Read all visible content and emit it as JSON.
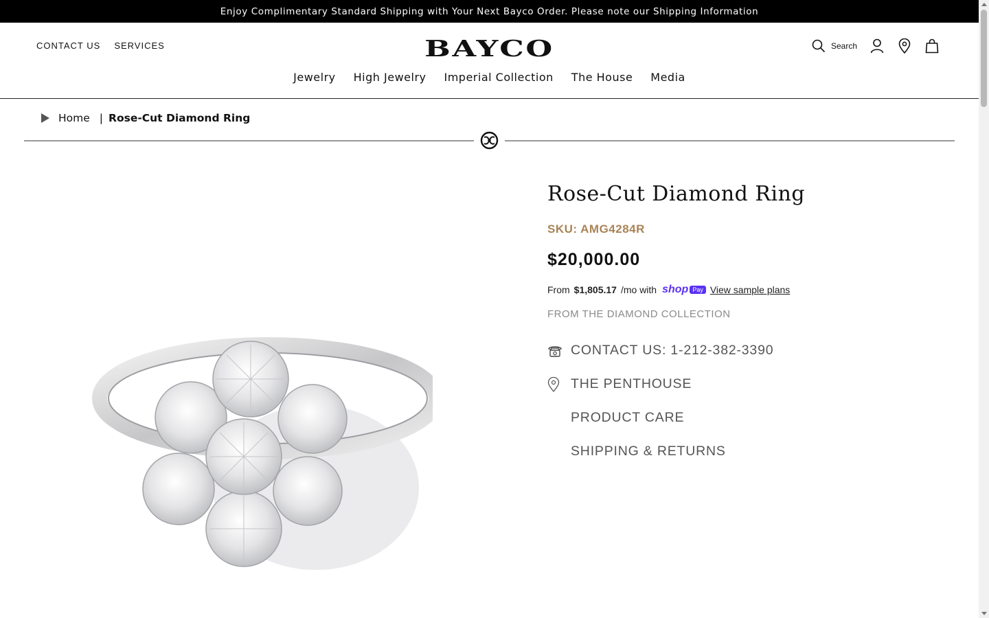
{
  "announcement": "Enjoy Complimentary Standard Shipping with Your Next Bayco Order. Please note our Shipping Information",
  "header": {
    "logo": "BAYCO",
    "util_left": [
      "CONTACT US",
      "SERVICES"
    ],
    "search_label": "Search",
    "icons": [
      "search-icon",
      "account-icon",
      "location-pin-icon",
      "shopping-bag-icon"
    ]
  },
  "nav": [
    "Jewelry",
    "High Jewelry",
    "Imperial Collection",
    "The House",
    "Media"
  ],
  "breadcrumb": {
    "home": "Home",
    "separator": "|",
    "current": "Rose-Cut Diamond Ring"
  },
  "product": {
    "title": "Rose-Cut Diamond Ring",
    "sku": "SKU: AMG4284R",
    "price": "$20,000.00",
    "installments": {
      "prefix": "From",
      "amount": "$1,805.17",
      "suffix": "/mo with",
      "brand_shop": "shop",
      "brand_pay": "Pay",
      "link": "View sample plans"
    },
    "collection": "FROM THE DIAMOND COLLECTION",
    "links": [
      {
        "label": "CONTACT US: 1-212-382-3390",
        "icon": "telephone-icon"
      },
      {
        "label": "THE PENTHOUSE",
        "icon": "location-pin-icon"
      },
      {
        "label": "PRODUCT CARE",
        "icon": ""
      },
      {
        "label": "SHIPPING & RETURNS",
        "icon": ""
      }
    ]
  },
  "colors": {
    "sku": "#a88457",
    "shoppay": "#5a31f4",
    "announcement_bg": "#000000"
  }
}
